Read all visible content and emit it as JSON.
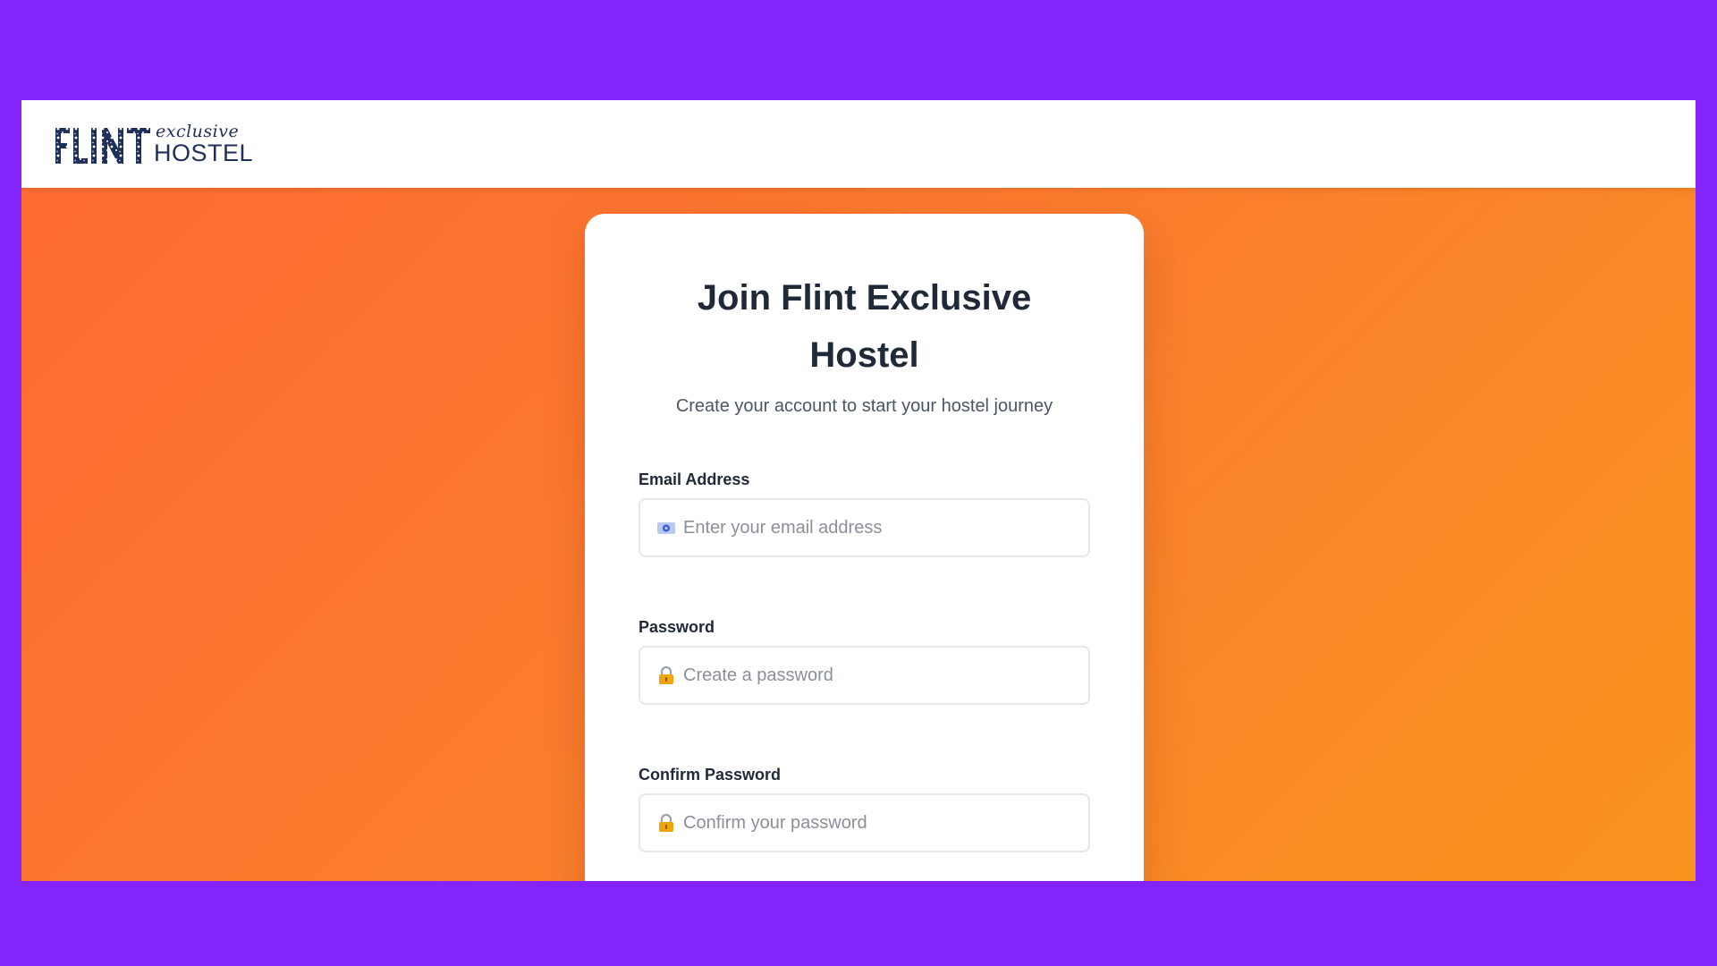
{
  "brand": {
    "logo_mark_text": "FLINT",
    "logo_script": "exclusive",
    "logo_word": "HOSTEL",
    "color": "#1e2f5a"
  },
  "theme": {
    "outer_bg": "#8224fb",
    "gradient_start": "#ff6a33",
    "gradient_end": "#f9941f"
  },
  "signup": {
    "title_line1": "Join Flint Exclusive",
    "title_line2": "Hostel",
    "subtitle": "Create your account to start your hostel journey",
    "email": {
      "label": "Email Address",
      "placeholder": "Enter your email address",
      "value": "",
      "icon": "email-icon"
    },
    "password": {
      "label": "Password",
      "placeholder": "Create a password",
      "value": "",
      "icon": "lock-icon"
    },
    "confirm_password": {
      "label": "Confirm Password",
      "placeholder": "Confirm your password",
      "value": "",
      "icon": "lock-icon"
    }
  }
}
